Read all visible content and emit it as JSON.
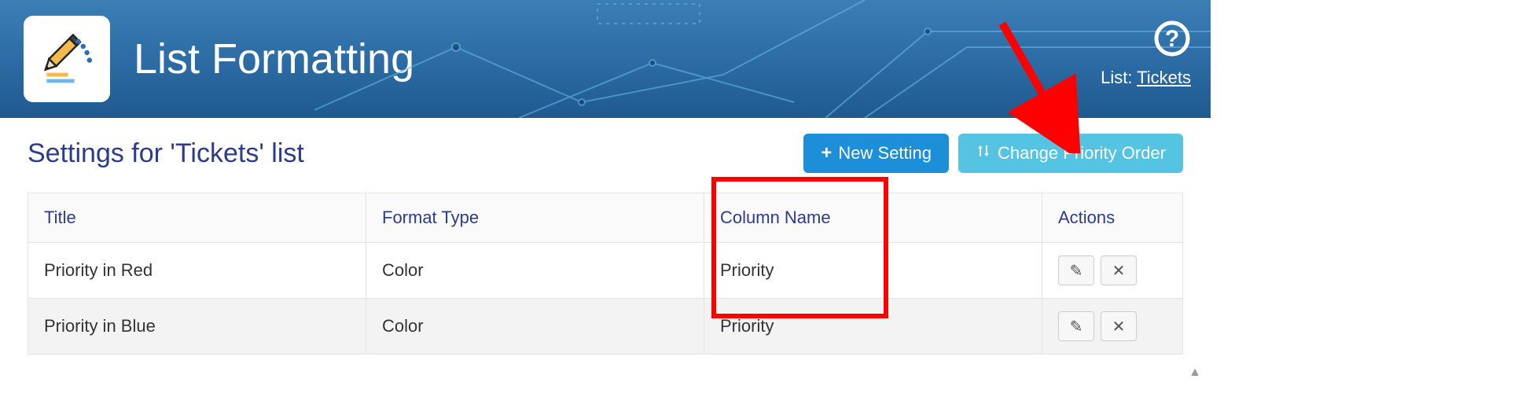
{
  "header": {
    "title": "List Formatting",
    "list_prefix": "List: ",
    "list_link": "Tickets"
  },
  "toolbar": {
    "subtitle": "Settings for 'Tickets' list",
    "new_setting_label": "New Setting",
    "change_order_label": "Change Priority Order"
  },
  "table": {
    "headers": {
      "title": "Title",
      "format_type": "Format Type",
      "column_name": "Column Name",
      "actions": "Actions"
    },
    "rows": [
      {
        "title": "Priority in Red",
        "format_type": "Color",
        "column_name": "Priority"
      },
      {
        "title": "Priority in Blue",
        "format_type": "Color",
        "column_name": "Priority"
      }
    ]
  },
  "icons": {
    "help": "help-icon",
    "plus": "+",
    "sort": "↑↓",
    "edit": "✎",
    "delete": "✕",
    "caret": "▲"
  }
}
